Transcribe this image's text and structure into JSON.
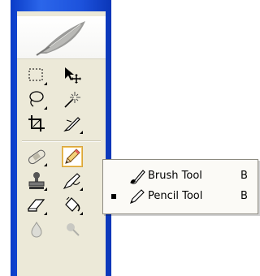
{
  "toolbox": {
    "tools": [
      {
        "name": "marquee-tool",
        "icon": "rectangular-marquee-icon"
      },
      {
        "name": "move-tool",
        "icon": "move-icon"
      },
      {
        "name": "lasso-tool",
        "icon": "lasso-icon"
      },
      {
        "name": "magic-wand-tool",
        "icon": "magic-wand-icon"
      },
      {
        "name": "crop-tool",
        "icon": "crop-icon"
      },
      {
        "name": "slice-tool",
        "icon": "slice-icon"
      },
      {
        "name": "healing-brush-tool",
        "icon": "bandage-icon"
      },
      {
        "name": "pencil-tool",
        "icon": "pencil-icon",
        "active": true
      },
      {
        "name": "clone-stamp-tool",
        "icon": "stamp-icon"
      },
      {
        "name": "history-brush-tool",
        "icon": "history-brush-icon"
      },
      {
        "name": "eraser-tool",
        "icon": "eraser-icon"
      },
      {
        "name": "paint-bucket-tool",
        "icon": "paint-bucket-icon"
      },
      {
        "name": "blur-tool",
        "icon": "blur-drop-icon"
      },
      {
        "name": "dodge-tool",
        "icon": "dodge-icon"
      }
    ]
  },
  "flyout": {
    "items": [
      {
        "label": "Brush Tool",
        "shortcut": "B",
        "selected": false,
        "icon": "brush-icon"
      },
      {
        "label": "Pencil Tool",
        "shortcut": "B",
        "selected": true,
        "icon": "pencil-icon"
      }
    ]
  },
  "colors": {
    "frame_blue": "#1d52dc",
    "toolbox_bg": "#ece9d8",
    "active_border": "#d9a43a"
  }
}
